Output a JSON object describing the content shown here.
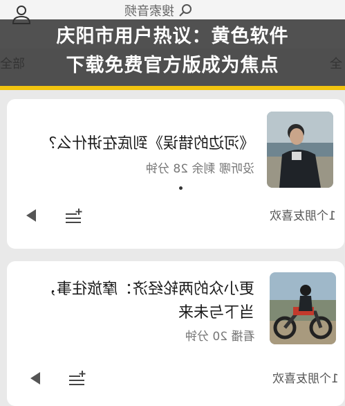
{
  "headline": {
    "line1": "庆阳市用户热议：黄色软件",
    "line2": "下载免费官方版成为焦点"
  },
  "appbar": {
    "search_text": "搜索音频",
    "right_tab": "全",
    "left_tab": "全部"
  },
  "colors": {
    "banner_accent": "#f2c40f",
    "card_bg": "#ffffff",
    "page_bg": "#e9e9e9"
  },
  "cards": [
    {
      "title": "《河边的错误》到底在讲什么？",
      "meta": "没听哪 剩余 28 分钟",
      "likes": "1个朋友喜欢",
      "thumbnail": "man-in-leather-jacket-photo"
    },
    {
      "title_line1": "更小众的两轮经济：摩旅往事，",
      "title_line2": "当下与未来",
      "meta": "看播 20 分钟",
      "likes": "1个朋友喜欢",
      "thumbnail": "motorcycle-rider-photo"
    }
  ],
  "icons": {
    "user": "user-icon",
    "search": "search-icon",
    "play": "play-icon",
    "playlist_add": "playlist-add-icon"
  }
}
